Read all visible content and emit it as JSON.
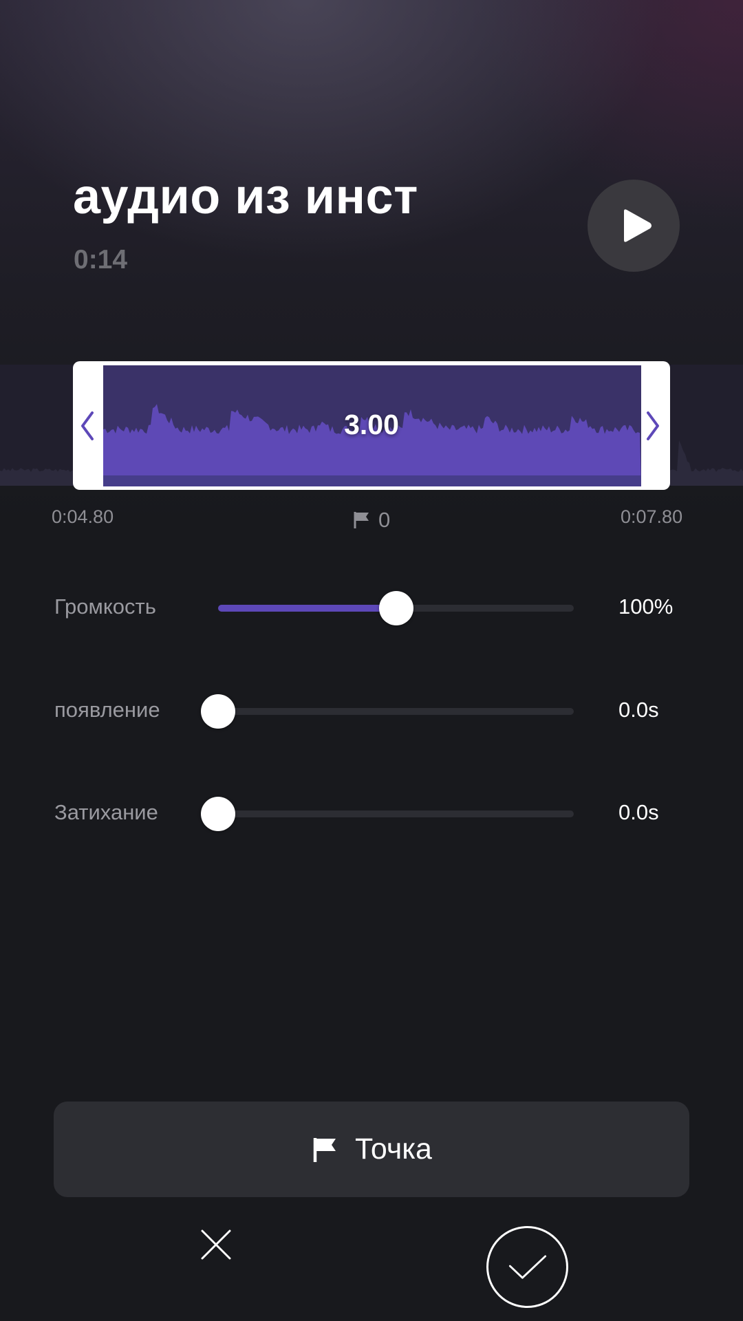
{
  "track": {
    "title": "аудио из инст",
    "duration": "0:14",
    "play_icon": "play-icon"
  },
  "trim": {
    "selection_length": "3.00",
    "start_time": "0:04.80",
    "end_time": "0:07.80",
    "marker_count": "0",
    "left_handle_icon": "chevron-left-icon",
    "right_handle_icon": "chevron-right-icon"
  },
  "controls": {
    "volume": {
      "label": "Громкость",
      "value_text": "100%",
      "level": 0.5
    },
    "fade_in": {
      "label": "появление",
      "value_text": "0.0s",
      "level": 0
    },
    "fade_out": {
      "label": "Затихание",
      "value_text": "0.0s",
      "level": 0
    }
  },
  "actions": {
    "add_marker_label": "Точка",
    "add_marker_icon": "flag-icon",
    "cancel_icon": "close-icon",
    "confirm_icon": "checkmark-icon"
  },
  "colors": {
    "accent": "#5d48b8",
    "waveform": "#5e49b6",
    "selection_background": "#3a3268",
    "background": "#18191d"
  }
}
